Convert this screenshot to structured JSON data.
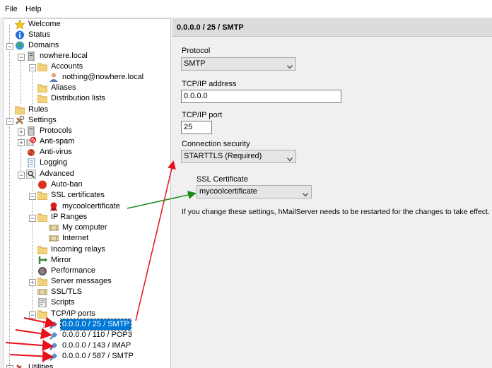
{
  "menu": [
    "File",
    "Help"
  ],
  "tree": {
    "welcome": "Welcome",
    "status": "Status",
    "domains": "Domains",
    "domain": "nowhere.local",
    "accounts": "Accounts",
    "account": "nothing@nowhere.local",
    "aliases": "Aliases",
    "distribution_lists": "Distribution lists",
    "rules": "Rules",
    "settings": "Settings",
    "protocols": "Protocols",
    "antispam": "Anti-spam",
    "antivirus": "Anti-virus",
    "logging": "Logging",
    "advanced": "Advanced",
    "autoban": "Auto-ban",
    "ssl_certificates": "SSL certificates",
    "certificate": "mycoolcertificate",
    "ip_ranges": "IP Ranges",
    "my_computer": "My computer",
    "internet": "Internet",
    "incoming_relays": "Incoming relays",
    "mirror": "Mirror",
    "performance": "Performance",
    "server_messages": "Server messages",
    "ssl_tls": "SSL/TLS",
    "scripts": "Scripts",
    "tcpip_ports": "TCP/IP ports",
    "ports": [
      "0.0.0.0 / 25 / SMTP",
      "0.0.0.0 / 110 / POP3",
      "0.0.0.0 / 143 / IMAP",
      "0.0.0.0 / 587 / SMTP"
    ],
    "utilities": "Utilities"
  },
  "panel": {
    "title": "0.0.0.0 / 25 / SMTP",
    "protocol_label": "Protocol",
    "protocol_value": "SMTP",
    "ip_label": "TCP/IP address",
    "ip_value": "0.0.0.0",
    "port_label": "TCP/IP port",
    "port_value": "25",
    "security_label": "Connection security",
    "security_value": "STARTTLS (Required)",
    "ssl_label": "SSL Certificate",
    "ssl_value": "mycoolcertificate",
    "note": "If you change these settings, hMailServer needs to be restarted for the changes to take effect."
  },
  "colors": {
    "selection": "#0078d7",
    "red_arrow": "#e8101a",
    "green_arrow": "#1a8a1a"
  }
}
